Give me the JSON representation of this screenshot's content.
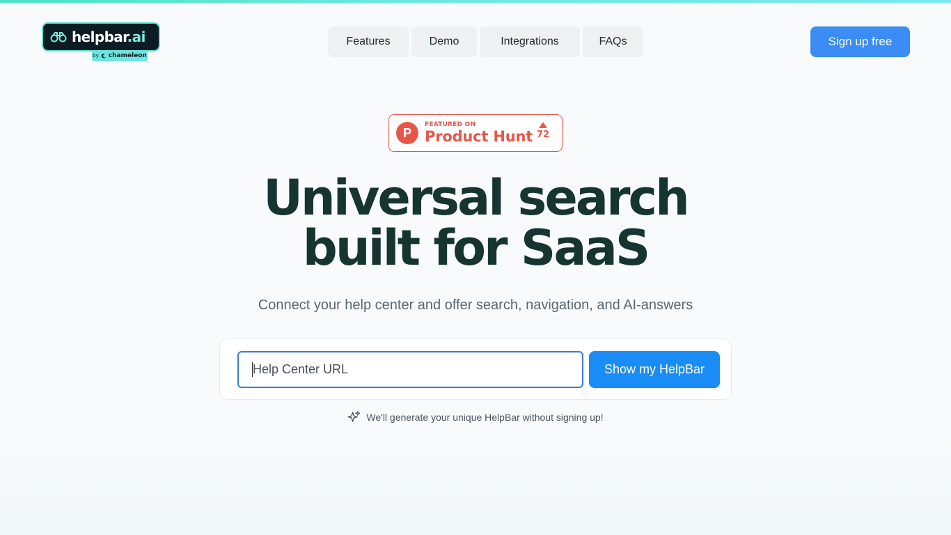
{
  "colors": {
    "accent": "#3b8cf5",
    "primary_button": "#1a8cf5",
    "heading": "#173530",
    "product_hunt": "#e8564a",
    "top_strip": "#5fe7c9"
  },
  "logo": {
    "name": "helpbar",
    "suffix": ".ai",
    "badge_by": "by",
    "badge_brand": "chameleon",
    "icon": "binoculars-icon"
  },
  "nav": {
    "items": [
      {
        "label": "Features"
      },
      {
        "label": "Demo"
      },
      {
        "label": "Integrations"
      },
      {
        "label": "FAQs"
      }
    ]
  },
  "header": {
    "signup_label": "Sign up free"
  },
  "product_hunt": {
    "featured_label": "FEATURED ON",
    "name": "Product Hunt",
    "logo_letter": "P",
    "votes": "72"
  },
  "hero": {
    "title_line1": "Universal search",
    "title_line2": "built for SaaS",
    "subtitle": "Connect your help center and offer search, navigation, and AI-answers"
  },
  "form": {
    "url_placeholder": "Help Center URL",
    "url_value": "",
    "submit_label": "Show my HelpBar",
    "note": "We'll generate your unique HelpBar without signing up!",
    "note_icon": "sparkle-icon"
  }
}
